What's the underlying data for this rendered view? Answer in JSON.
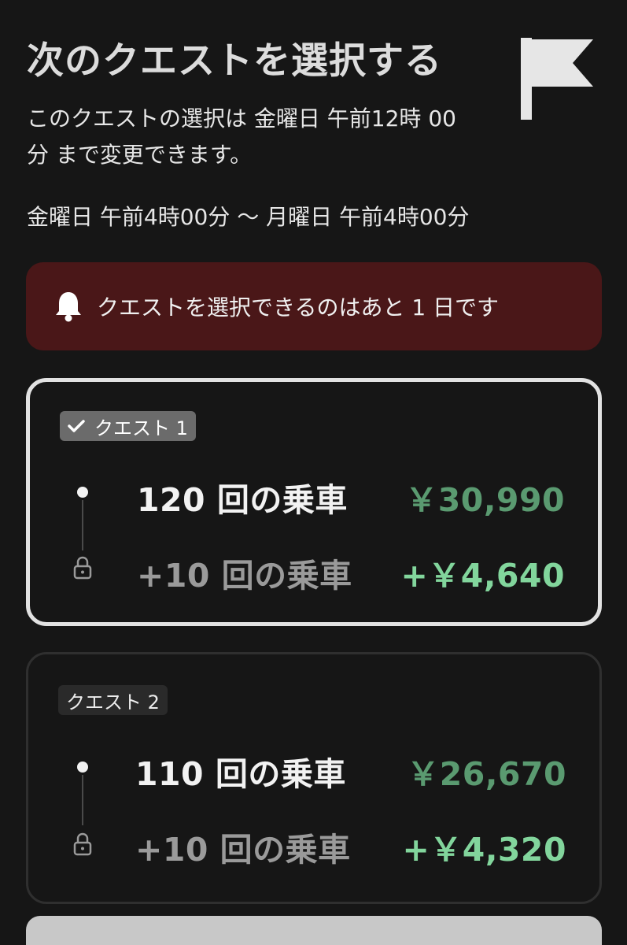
{
  "header": {
    "title": "次のクエストを選択する",
    "flag_icon": "flag-icon"
  },
  "change_note": "このクエストの選択は 金曜日 午前12時 00分 まで変更できます。",
  "period": "金曜日 午前4時00分 〜 月曜日 午前4時00分",
  "alert": {
    "icon": "bell-icon",
    "text": "クエストを選択できるのはあと 1 日です",
    "background": "#4a1718"
  },
  "quests": [
    {
      "tag": "クエスト 1",
      "selected": true,
      "base_label": "120 回の乗車",
      "base_amount": "￥30,990",
      "bonus_label": "+10 回の乗車",
      "bonus_amount": "+￥4,640"
    },
    {
      "tag": "クエスト 2",
      "selected": false,
      "base_label": "110 回の乗車",
      "base_amount": "￥26,670",
      "bonus_label": "+10 回の乗車",
      "bonus_amount": "+￥4,320"
    }
  ],
  "colors": {
    "amount_base": "#5a9a70",
    "amount_bonus": "#82d59c",
    "selected_border": "#e2e2e2"
  }
}
